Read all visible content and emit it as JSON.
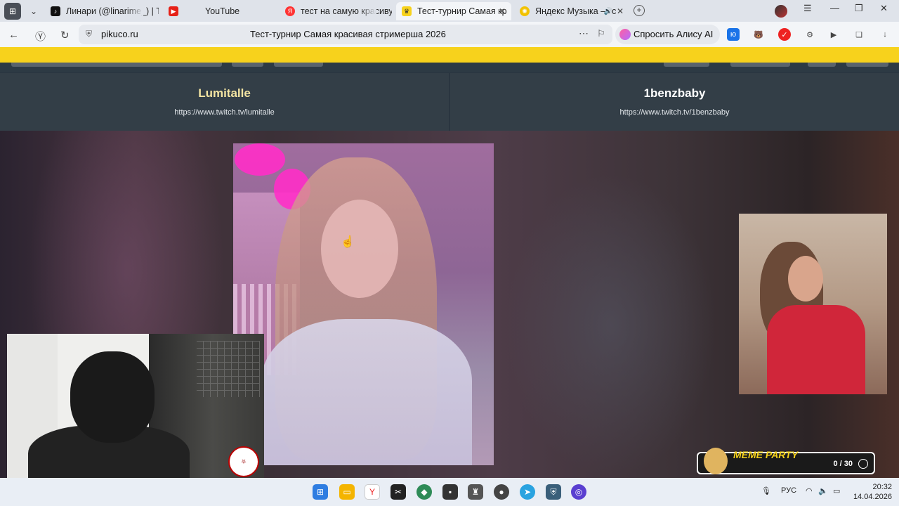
{
  "browser": {
    "tabs": [
      {
        "label": "Линари (@linarime_) | Tik",
        "favicon": "tiktok-icon",
        "active": false
      },
      {
        "label": "YouTube",
        "favicon": "youtube-icon",
        "active": false
      },
      {
        "label": "тест на самую красивую",
        "favicon": "yandex-icon",
        "active": false
      },
      {
        "label": "Тест-турнир Самая кр",
        "favicon": "crown-icon",
        "active": true
      },
      {
        "label": "Яндекс Музыка — с",
        "favicon": "music-icon",
        "active": false
      }
    ],
    "domain": "pikuco.ru",
    "page_title": "Тест-турнир Самая красивая стримерша 2026",
    "alice_button": "Спросить Алису AI"
  },
  "site": {
    "accent_color": "#f7d21c",
    "left": {
      "name": "Lumitalle",
      "link": "https://www.twitch.tv/lumitalle",
      "name_color": "#f3e4a2"
    },
    "right": {
      "name": "1benzbaby",
      "link": "https://www.twitch.tv/1benzbaby",
      "name_color": "#ffffff"
    }
  },
  "overlay": {
    "meme_title": "MEME PARTY",
    "meme_count": "0 / 30"
  },
  "taskbar": {
    "language": "РУС",
    "time": "20:32",
    "date": "14.04.2026"
  }
}
